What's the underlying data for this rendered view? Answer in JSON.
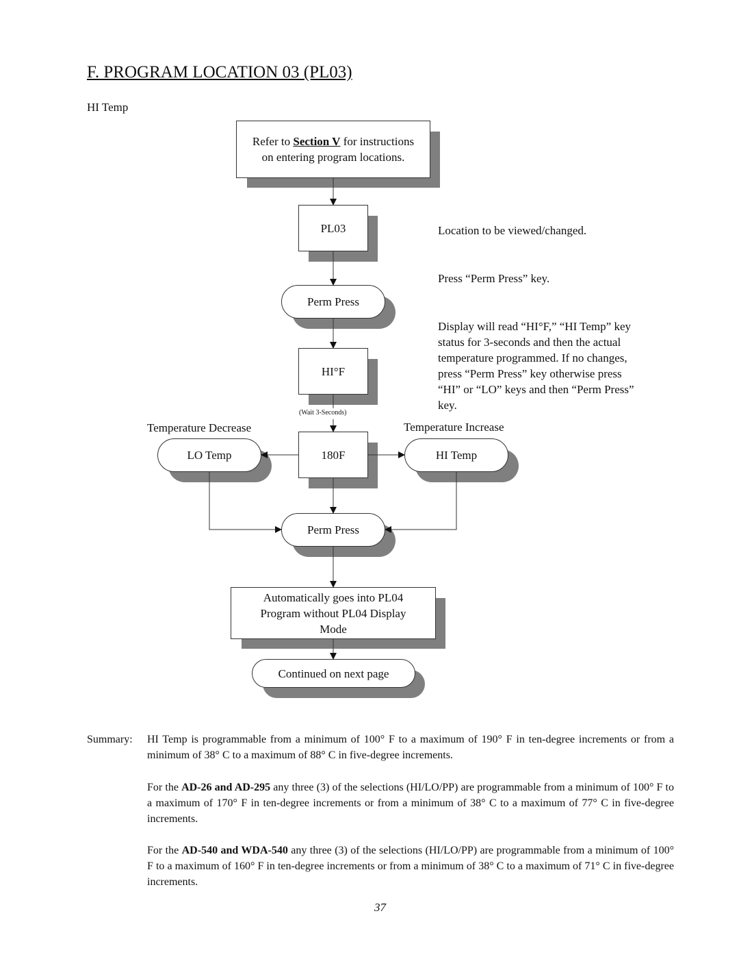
{
  "page": {
    "title": "F.  PROGRAM LOCATION 03 (PL03)",
    "subtitle": "HI Temp",
    "page_number": "37"
  },
  "flowchart": {
    "intro_box": {
      "prefix": "Refer to ",
      "link": "Section V",
      "suffix": " for instructions",
      "line2": "on entering program locations."
    },
    "pl03_box": "PL03",
    "perm_press_1": "Perm Press",
    "hi_f_box": "HI°F",
    "wait_label": "(Wait 3-Seconds)",
    "decrease_label": "Temperature  Decrease",
    "increase_label": "Temperature  Increase",
    "lo_temp": "LO Temp",
    "value_box": "180F",
    "hi_temp": "HI Temp",
    "perm_press_2": "Perm Press",
    "auto_box": [
      "Automatically goes into PL04",
      "Program without PL04 Display",
      "Mode"
    ],
    "continued": "Continued on next page"
  },
  "notes": {
    "location": "Location to be viewed/changed.",
    "press": "Press  “Perm  Press”  key.",
    "display": [
      "Display will read “HI°F,” “HI Temp” key",
      "status for 3-seconds and then the actual",
      "temperature programmed.  If no changes,",
      "press “Perm Press” key otherwise press",
      "“HI” or “LO” keys and then “Perm Press”",
      "key."
    ]
  },
  "summary": {
    "label": "Summary:",
    "p1": "HI Temp is programmable from a minimum of 100° F to a maximum of 190° F in ten-degree increments or from a minimum of 38° C to a maximum of 88° C in five-degree increments.",
    "p2_prefix": "For the ",
    "p2_bold": "AD-26 and AD-295",
    "p2_rest": " any three (3) of the selections (HI/LO/PP) are programmable from a minimum of 100° F to a maximum of 170° F in ten-degree increments or from a minimum of 38° C to a maximum of 77° C in five-degree increments.",
    "p3_prefix": "For the ",
    "p3_bold": "AD-540 and WDA-540",
    "p3_rest": " any three (3) of the selections (HI/LO/PP) are programmable from a minimum of 100° F to a maximum of 160° F in ten-degree increments or from a minimum of 38° C to a maximum of 71° C in five-degree increments."
  }
}
